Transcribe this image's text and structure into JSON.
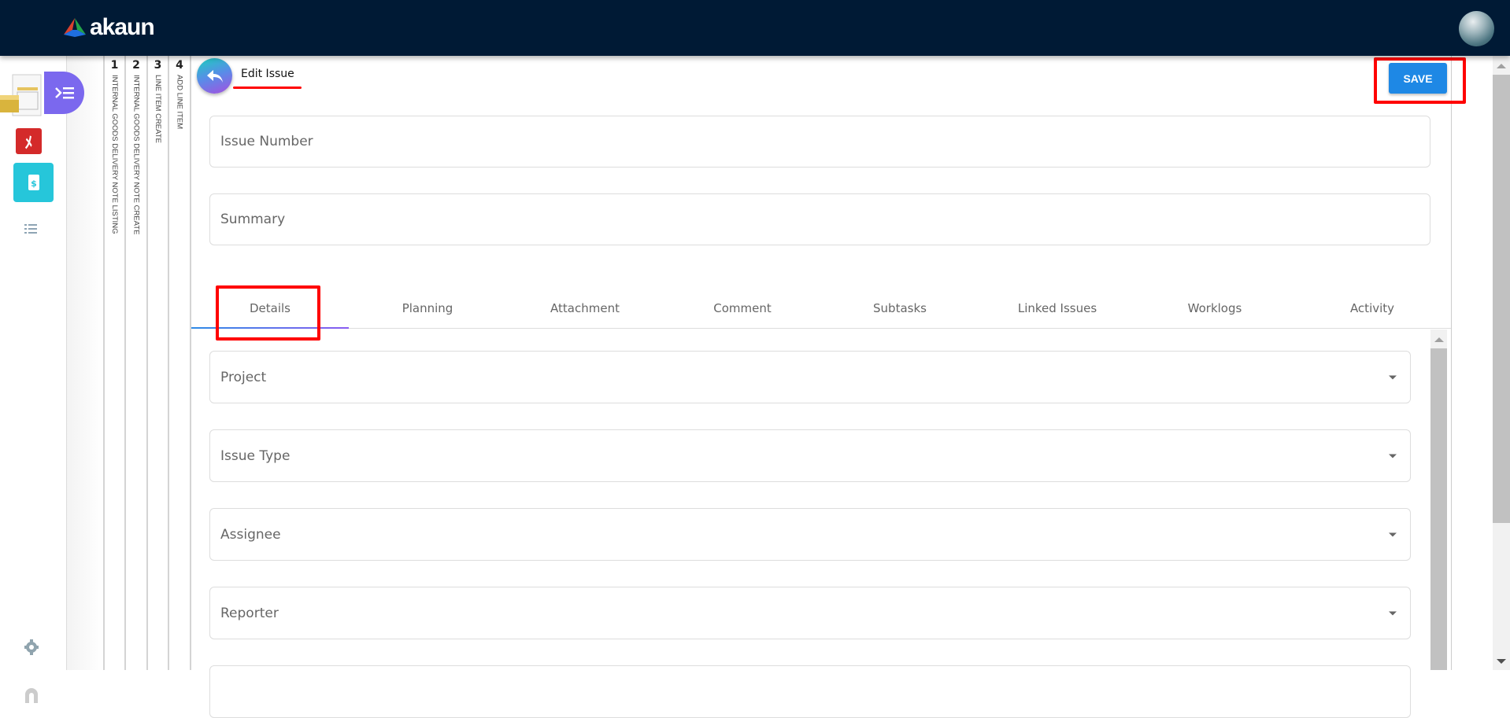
{
  "header": {
    "brand": "akaun"
  },
  "breadcrumbs": [
    {
      "num": "1",
      "label": "INTERNAL GOODS DELIVERY NOTE LISTING"
    },
    {
      "num": "2",
      "label": "INTERNAL GOODS DELIVERY NOTE CREATE"
    },
    {
      "num": "3",
      "label": "LINE ITEM CREATE"
    },
    {
      "num": "4",
      "label": "ADD LINE ITEM"
    }
  ],
  "page": {
    "title": "Edit Issue",
    "save_label": "SAVE"
  },
  "fields": {
    "issue_number": "Issue Number",
    "summary": "Summary"
  },
  "tabs": [
    "Details",
    "Planning",
    "Attachment",
    "Comment",
    "Subtasks",
    "Linked Issues",
    "Worklogs",
    "Activity"
  ],
  "active_tab": "Details",
  "details": {
    "project": "Project",
    "issue_type": "Issue Type",
    "assignee": "Assignee",
    "reporter": "Reporter"
  },
  "colors": {
    "header": "#001a35",
    "save": "#1e88e5",
    "highlight": "#ff0000"
  }
}
